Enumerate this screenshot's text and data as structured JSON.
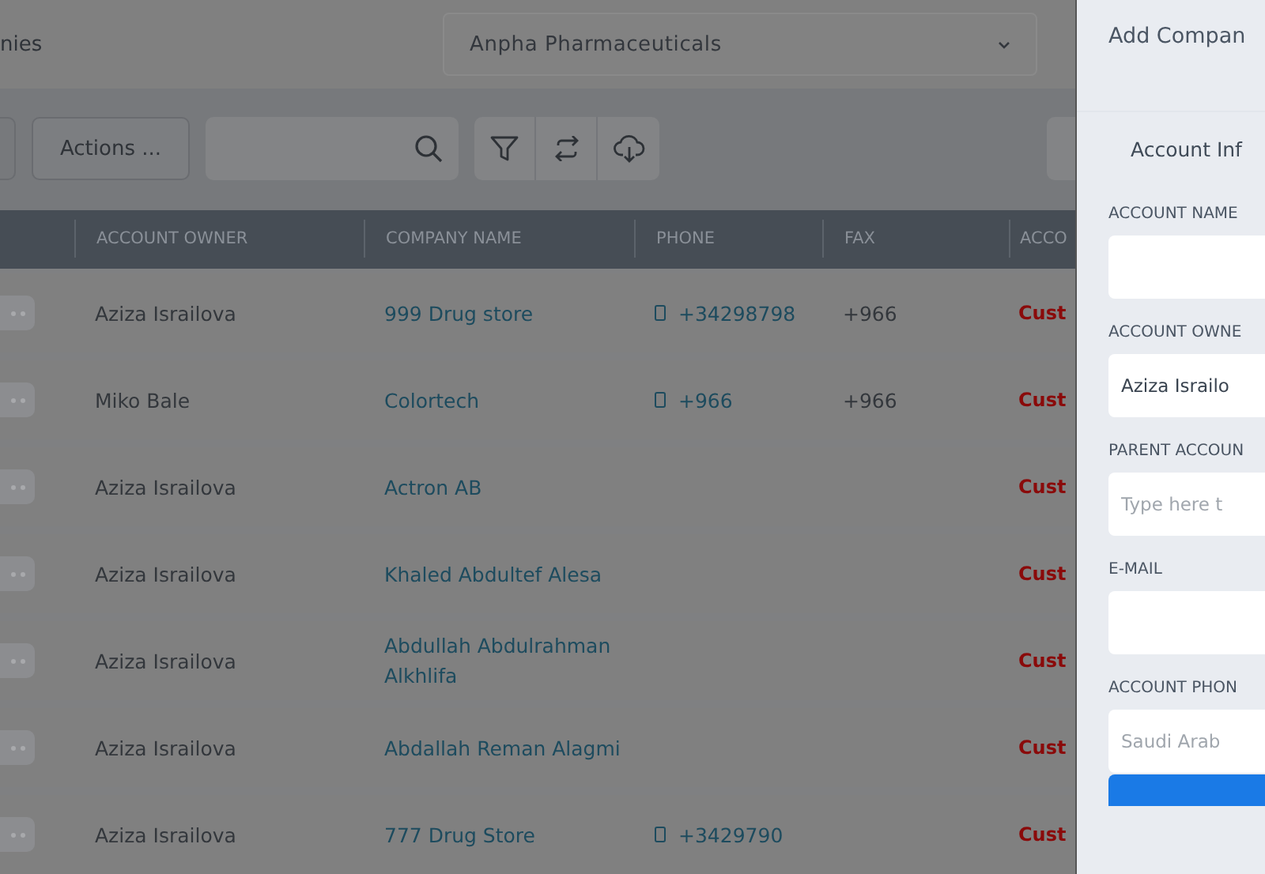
{
  "page_title": "nies",
  "company_select": {
    "value": "Anpha Pharmaceuticals"
  },
  "toolbar": {
    "actions_button": "Actions ..."
  },
  "table": {
    "columns": [
      "ACCOUNT OWNER",
      "COMPANY NAME",
      "PHONE",
      "FAX",
      "ACCO"
    ],
    "rows": [
      {
        "owner": "Aziza Israilova",
        "company": "999 Drug store",
        "phone": "+34298798",
        "fax": "+966",
        "account": "Cust"
      },
      {
        "owner": "Miko Bale",
        "company": "Colortech",
        "phone": "+966",
        "fax": "+966",
        "account": "Cust"
      },
      {
        "owner": "Aziza Israilova",
        "company": "Actron AB",
        "account": "Cust"
      },
      {
        "owner": "Aziza Israilova",
        "company": "Khaled Abdultef Alesa",
        "account": "Cust"
      },
      {
        "owner": "Aziza Israilova",
        "company": "Abdullah Abdulrahman Alkhlifa",
        "account": "Cust"
      },
      {
        "owner": "Aziza Israilova",
        "company": "Abdallah Reman Alagmi",
        "account": "Cust"
      },
      {
        "owner": "Aziza Israilova",
        "company": "777 Drug Store",
        "phone": "+3429790",
        "account": "Cust"
      }
    ]
  },
  "drawer": {
    "title": "Add Compan",
    "section": "Account Inf",
    "fields": [
      {
        "label": "ACCOUNT NAME"
      },
      {
        "label": "ACCOUNT OWNE",
        "value": "Aziza Israilo"
      },
      {
        "label": "PARENT ACCOUN",
        "placeholder": "Type here t"
      },
      {
        "label": "E-MAIL"
      },
      {
        "label": "ACCOUNT PHON",
        "placeholder": "Saudi Arab"
      }
    ]
  }
}
